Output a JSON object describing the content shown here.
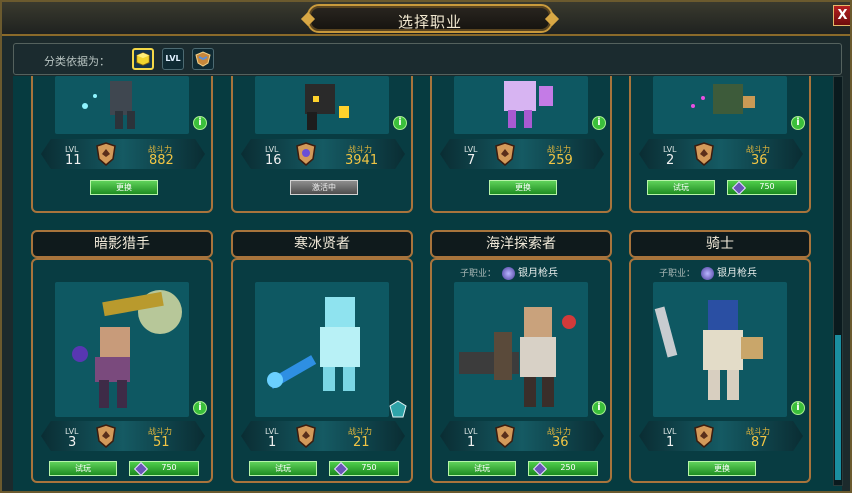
{
  "window": {
    "title": "选择职业",
    "close_label": "X"
  },
  "filter": {
    "label": "分类依据为：",
    "options": [
      {
        "icon": "cube-icon"
      },
      {
        "icon": "level-icon",
        "label": "LVL"
      },
      {
        "icon": "rank-emblem-icon"
      }
    ]
  },
  "colors": {
    "frame_gold": "#a8743c",
    "panel_teal": "#063b40",
    "button_green": "#3cbf3c",
    "power_yellow": "#f1c544"
  },
  "stat_labels": {
    "level": "LVL",
    "power": "战斗力"
  },
  "row1": [
    {
      "level": "11",
      "power": "882",
      "button": "更换"
    },
    {
      "level": "16",
      "power": "3941",
      "button": "激活中"
    },
    {
      "level": "7",
      "power": "259",
      "button": "更换"
    },
    {
      "level": "2",
      "power": "36",
      "button": "试玩",
      "price": "750"
    }
  ],
  "row2": [
    {
      "name": "暗影猎手",
      "level": "3",
      "power": "51",
      "button": "试玩",
      "price": "750"
    },
    {
      "name": "寒冰贤者",
      "level": "1",
      "power": "21",
      "button": "试玩",
      "price": "750"
    },
    {
      "name": "海洋探索者",
      "subclass_label": "子职业：",
      "subclass": "银月枪兵",
      "level": "1",
      "power": "36",
      "button": "试玩",
      "price": "250"
    },
    {
      "name": "骑士",
      "subclass_label": "子职业：",
      "subclass": "银月枪兵",
      "level": "1",
      "power": "87",
      "button": "更换"
    }
  ],
  "info_label": "i"
}
